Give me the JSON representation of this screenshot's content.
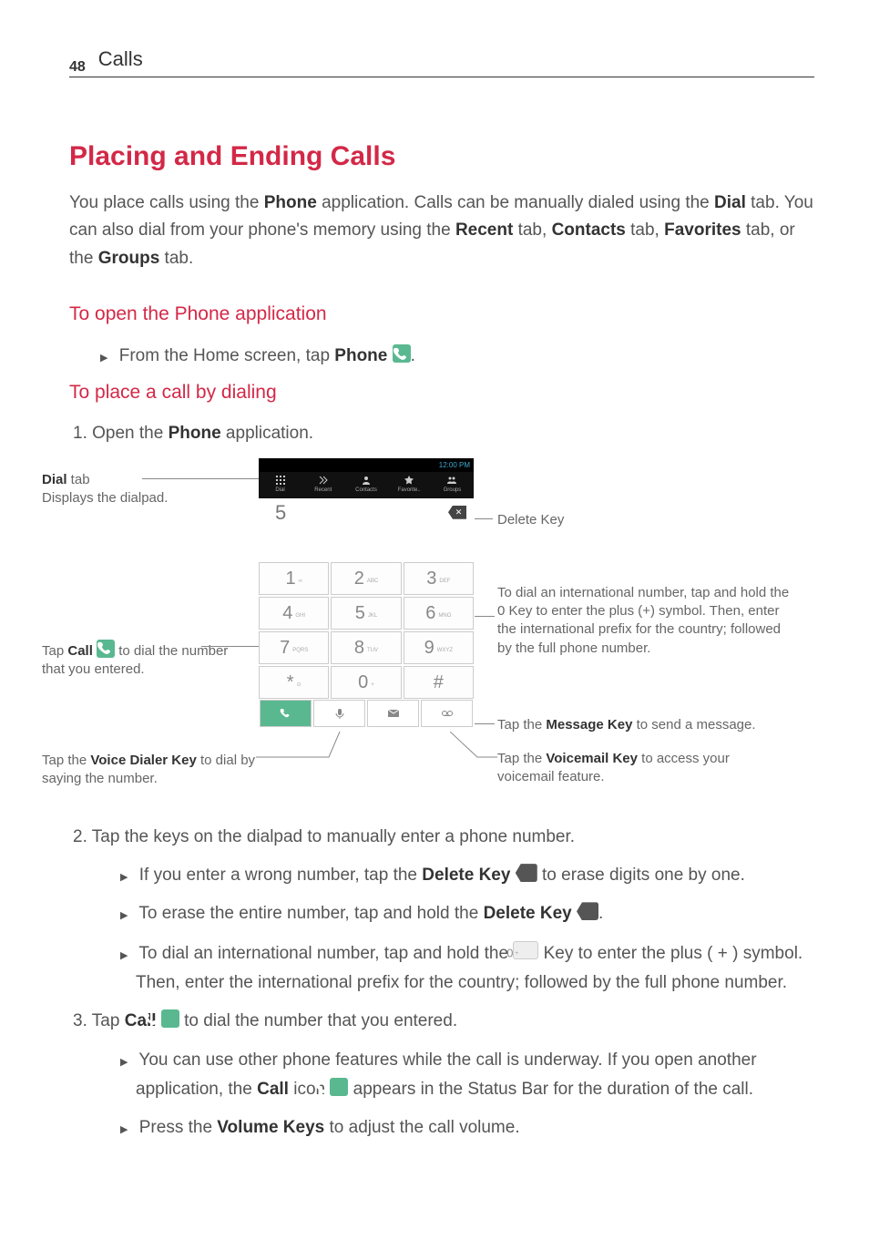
{
  "page": {
    "number": "48",
    "section": "Calls"
  },
  "h1": "Placing and Ending Calls",
  "intro": {
    "part1": "You place calls using the ",
    "b1": "Phone",
    "part2": " application. Calls can be manually dialed using the ",
    "b2": "Dial",
    "part3": " tab. You can also dial from your phone's memory using the ",
    "b3": "Recent",
    "part4": " tab, ",
    "b4": "Contacts",
    "part5": " tab, ",
    "b5": "Favorites",
    "part6": " tab, or the ",
    "b6": "Groups",
    "part7": " tab."
  },
  "h2a": "To open the Phone application",
  "step_open": {
    "text1": "From the Home screen, tap ",
    "b1": "Phone ",
    "text2": "."
  },
  "h2b": "To place a call by dialing",
  "step1": {
    "num": "1.",
    "text1": " Open the ",
    "b1": "Phone",
    "text2": " application."
  },
  "diagram": {
    "statusbar_time": "12:00 PM",
    "tabs": {
      "dial": "Dial",
      "recent": "Recent",
      "contacts": "Contacts",
      "favorite": "Favorite..",
      "groups": "Groups"
    },
    "display_num": "5",
    "keypad": {
      "1": "1",
      "2": "2",
      "2s": "ABC",
      "3": "3",
      "3s": "DEF",
      "4": "4",
      "4s": "GHI",
      "5": "5",
      "5s": "JKL",
      "6": "6",
      "6s": "MNO",
      "7": "7",
      "7s": "PQRS",
      "8": "8",
      "8s": "TUV",
      "9": "9",
      "9s": "WXYZ",
      "star": "*",
      "0": "0",
      "0s": "+",
      "hash": "#"
    },
    "callouts": {
      "dial_tab_title": "Dial",
      "dial_tab_text": " tab\nDisplays the dialpad.",
      "delete_key": "Delete Key",
      "call_text1": "Tap ",
      "call_b": "Call ",
      "call_text2": " to dial the number that you entered.",
      "voice_b": "Voice Dialer Key",
      "voice_text": " to dial by saying the number.",
      "voice_pre": "Tap the ",
      "intl": "To dial an international number, tap and hold the 0 Key to enter the plus (+) symbol. Then, enter the international prefix for the country; followed by the full phone number.",
      "msg_pre": "Tap the ",
      "msg_b": "Message Key",
      "msg_text": " to send a message.",
      "vm_pre": "Tap the ",
      "vm_b": "Voicemail Key",
      "vm_text": " to access your voicemail feature."
    }
  },
  "step2": {
    "num": "2.",
    "text": " Tap the keys on the dialpad to manually enter a phone number."
  },
  "sub2a": {
    "text1": "If you enter a wrong number, tap the ",
    "b1": "Delete Key ",
    "text2": " to erase digits one by one."
  },
  "sub2b": {
    "text1": "To erase the entire number, tap and hold the ",
    "b1": "Delete Key ",
    "text2": "."
  },
  "sub2c": {
    "text1": "To dial an international number, tap and hold the ",
    "text2": " Key to enter the plus ( + ) symbol. Then, enter the international prefix for the country; followed by the full phone number."
  },
  "step3": {
    "num": "3.",
    "text1": " Tap ",
    "b1": "Call ",
    "text2": " to dial the number that you entered."
  },
  "sub3a": {
    "text1": "You can use other phone features while the call is underway. If you open another application, the ",
    "b1": "Call",
    "text2": " icon ",
    "text3": " appears in the Status Bar for the duration of the call."
  },
  "sub3b": {
    "text1": "Press the ",
    "b1": "Volume Keys",
    "text2": " to adjust the call volume."
  }
}
